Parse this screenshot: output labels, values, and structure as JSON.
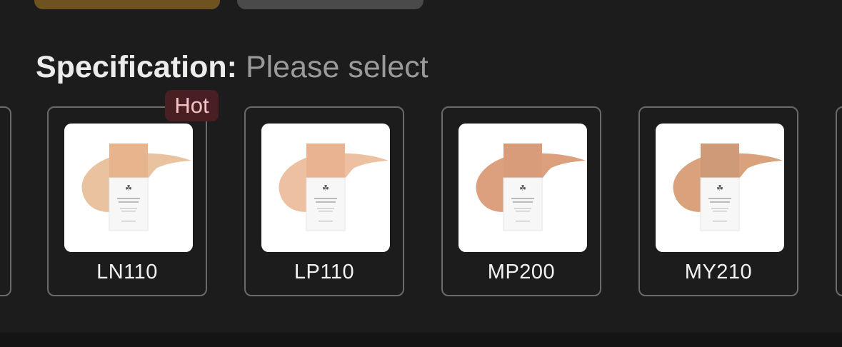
{
  "spec": {
    "label": "Specification:",
    "value": "Please select"
  },
  "badge": {
    "hot": "Hot"
  },
  "options": [
    {
      "label": "LN110",
      "swatch": "#e9c39f",
      "bottle": "#e7b48e"
    },
    {
      "label": "LP110",
      "swatch": "#ecc0a0",
      "bottle": "#e9b290"
    },
    {
      "label": "MP200",
      "swatch": "#dca07e",
      "bottle": "#d99c7a"
    },
    {
      "label": "MY210",
      "swatch": "#d9a27c",
      "bottle": "#cf9a78"
    }
  ],
  "colors": {
    "background": "#1c1c1c",
    "accent_gold": "#6e5320",
    "badge_bg": "#4a1f24",
    "badge_text": "#f4c3c6"
  }
}
